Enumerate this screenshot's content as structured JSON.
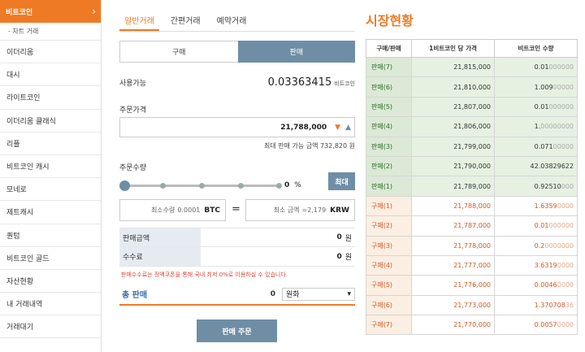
{
  "sidebar": {
    "active": "비트코인",
    "sub": "- 차트 거래",
    "items": [
      "이더리움",
      "대시",
      "라이트코인",
      "이더리움 클래식",
      "리플",
      "비트코인 캐시",
      "모네로",
      "제트캐시",
      "퀀텀",
      "비트코인 골드",
      "자산현황",
      "내 거래내역",
      "거래대기"
    ]
  },
  "tabs": [
    "일반거래",
    "간편거래",
    "예약거래"
  ],
  "toggle": {
    "buy": "구매",
    "sell": "판매"
  },
  "available": {
    "label": "사용가능",
    "value": "0.03363415",
    "unit": "비트코인"
  },
  "order_price": {
    "label": "주문가격",
    "value": "21,788,000",
    "max_line": "최대 판매 가능 금액 732,820 원"
  },
  "order_qty": {
    "label": "주문수량",
    "percent": "0",
    "percent_unit": "%",
    "max_button": "최대",
    "slider_fraction": 0
  },
  "min_qty": {
    "label": "최소수량",
    "value": "0.0001",
    "unit": "BTC"
  },
  "min_amount": {
    "label": "최소 금액",
    "value": "=2,179",
    "unit": "KRW"
  },
  "eq": "=",
  "summary": [
    {
      "key": "판매금액",
      "value": "0",
      "unit": "원"
    },
    {
      "key": "수수료",
      "value": "0",
      "unit": "원"
    }
  ],
  "note": "판매수수료는 정액쿠폰을 통해 국내 최저 0%로 이용하실 수 있습니다.",
  "total": {
    "label": "총 판매",
    "value": "0",
    "currency": "원화"
  },
  "submit": "판매 주문",
  "market": {
    "title": "시장현황",
    "headers": [
      "구매/판매",
      "1비트코인 당 가격",
      "비트코인 수량"
    ],
    "rows": [
      {
        "side": "판매(7)",
        "price": "21,815,000",
        "qty_main": "0.01",
        "qty_fade": "000000",
        "type": "sell"
      },
      {
        "side": "판매(6)",
        "price": "21,810,000",
        "qty_main": "1.009",
        "qty_fade": "00000",
        "type": "sell"
      },
      {
        "side": "판매(5)",
        "price": "21,807,000",
        "qty_main": "0.01",
        "qty_fade": "000000",
        "type": "sell"
      },
      {
        "side": "판매(4)",
        "price": "21,806,000",
        "qty_main": "1.",
        "qty_fade": "00000000",
        "type": "sell"
      },
      {
        "side": "판매(3)",
        "price": "21,799,000",
        "qty_main": "0.071",
        "qty_fade": "00000",
        "type": "sell"
      },
      {
        "side": "판매(2)",
        "price": "21,790,000",
        "qty_main": "42.03829622",
        "qty_fade": "",
        "type": "sell"
      },
      {
        "side": "판매(1)",
        "price": "21,789,000",
        "qty_main": "0.92510",
        "qty_fade": "000",
        "type": "sell"
      },
      {
        "side": "구매(1)",
        "price": "21,788,000",
        "qty_main": "1.6359",
        "qty_fade": "0000",
        "type": "buy"
      },
      {
        "side": "구매(2)",
        "price": "21,787,000",
        "qty_main": "0.01",
        "qty_fade": "000000",
        "type": "buy"
      },
      {
        "side": "구매(3)",
        "price": "21,778,000",
        "qty_main": "0.2",
        "qty_fade": "0000000",
        "type": "buy"
      },
      {
        "side": "구매(4)",
        "price": "21,777,000",
        "qty_main": "3.6319",
        "qty_fade": "0000",
        "type": "buy"
      },
      {
        "side": "구매(5)",
        "price": "21,776,000",
        "qty_main": "0.0046",
        "qty_fade": "0000",
        "type": "buy"
      },
      {
        "side": "구매(6)",
        "price": "21,773,000",
        "qty_main": "1.370708",
        "qty_fade": "36",
        "type": "buy"
      },
      {
        "side": "구매(7)",
        "price": "21,770,000",
        "qty_main": "0.0057",
        "qty_fade": "0000",
        "type": "buy"
      }
    ]
  },
  "colors": {
    "accent": "#ef7a25",
    "primary": "#6f8ea6",
    "sell_bg": "#e6f1e2",
    "buy_text": "#d2561f"
  }
}
